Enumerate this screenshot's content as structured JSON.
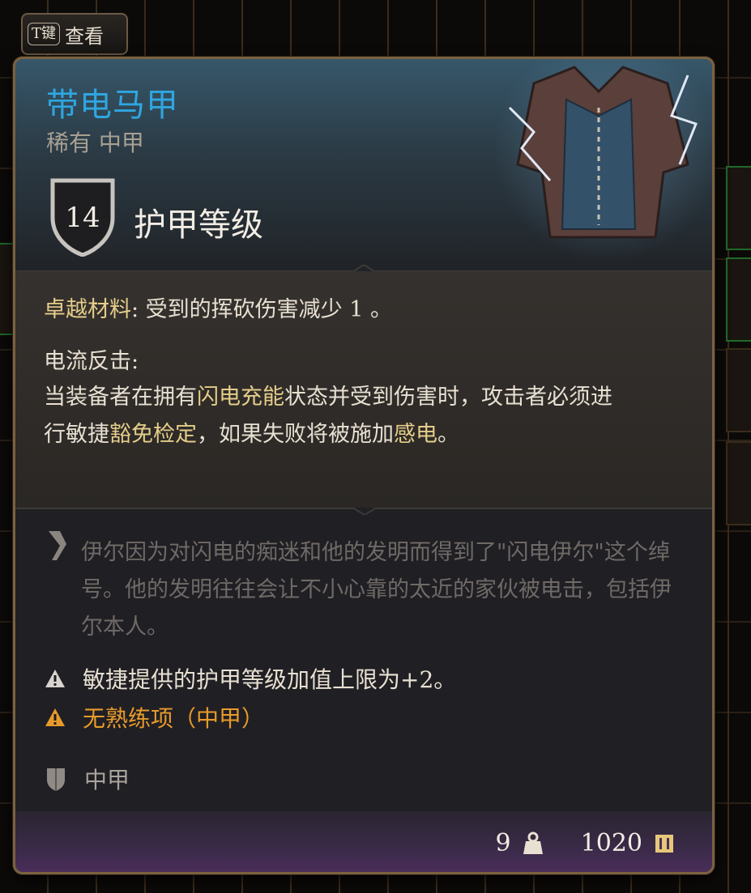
{
  "hint": {
    "key": "T键",
    "label": "查看"
  },
  "item": {
    "name": "带电马甲",
    "subtitle": "稀有 中甲",
    "armor_class": "14",
    "armor_class_label": "护甲等级"
  },
  "properties": {
    "p1_name": "卓越材料",
    "p1_text": ": 受到的挥砍伤害减少 1 。",
    "p2_name": "电流反击:",
    "p3_a": "当装备者在拥有",
    "p3_link1": "闪电充能",
    "p3_b": "状态并受到伤害时，攻击者必须进行敏捷",
    "p3_link2": "豁免检定",
    "p3_c": "，如果失败将被施加",
    "p3_link3": "感电",
    "p3_d": "。"
  },
  "lore": "伊尔因为对闪电的痴迷和他的发明而得到了\"闪电伊尔\"这个绰号。他的发明往往会让不小心靠的太近的家伙被电击，包括伊尔本人。",
  "warnings": [
    {
      "text": "敏捷提供的护甲等级加值上限为+2。",
      "color": "#e8e0d2"
    },
    {
      "text": "无熟练项（中甲）",
      "color": "#e89a2a"
    }
  ],
  "category": "中甲",
  "footer": {
    "weight": "9",
    "value": "1020"
  },
  "icons": {
    "shield": "shield-icon",
    "lore": "quill-icon",
    "warning": "warning-triangle-icon",
    "armor": "armor-shield-icon",
    "weight": "weight-icon",
    "gold": "gold-coin-icon"
  },
  "colors": {
    "title": "#2fa6e0",
    "highlight": "#e5cd8a",
    "warning_orange": "#e89a2a",
    "border": "#7a6140"
  }
}
